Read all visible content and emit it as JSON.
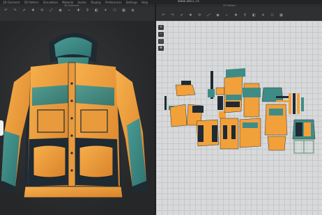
{
  "menubar": {
    "items": [
      "3D Garment",
      "2D Pattern",
      "Simulation",
      "Material",
      "Avatar",
      "Display",
      "Preferences",
      "Settings",
      "Help"
    ]
  },
  "title": "www.3DCC.cc",
  "window": {
    "left_title": "3D Garment",
    "right_title": "2D Pattern"
  },
  "colors": {
    "orange": "#f2a03a",
    "teal": "#3f8c87",
    "navy": "#1f2a33",
    "bg_dark": "#2b2c2e",
    "grid": "#d8d9da"
  },
  "icons": {
    "left_tools": [
      "undo-icon",
      "redo-icon",
      "select-icon",
      "move-icon",
      "rotate-icon",
      "scale-icon",
      "pin-icon",
      "fold-icon",
      "tack-icon",
      "zoom-icon",
      "view-icon",
      "light-icon",
      "camera-icon",
      "grid-icon",
      "render-icon"
    ],
    "right_tools": [
      "select-pattern-icon",
      "edit-point-icon",
      "polygon-icon",
      "rectangle-icon",
      "circle-icon",
      "dart-icon",
      "seam-icon",
      "segment-icon",
      "internal-line-icon",
      "notch-icon",
      "arrange-icon",
      "flip-icon",
      "texture-icon",
      "symmetry-icon"
    ]
  }
}
